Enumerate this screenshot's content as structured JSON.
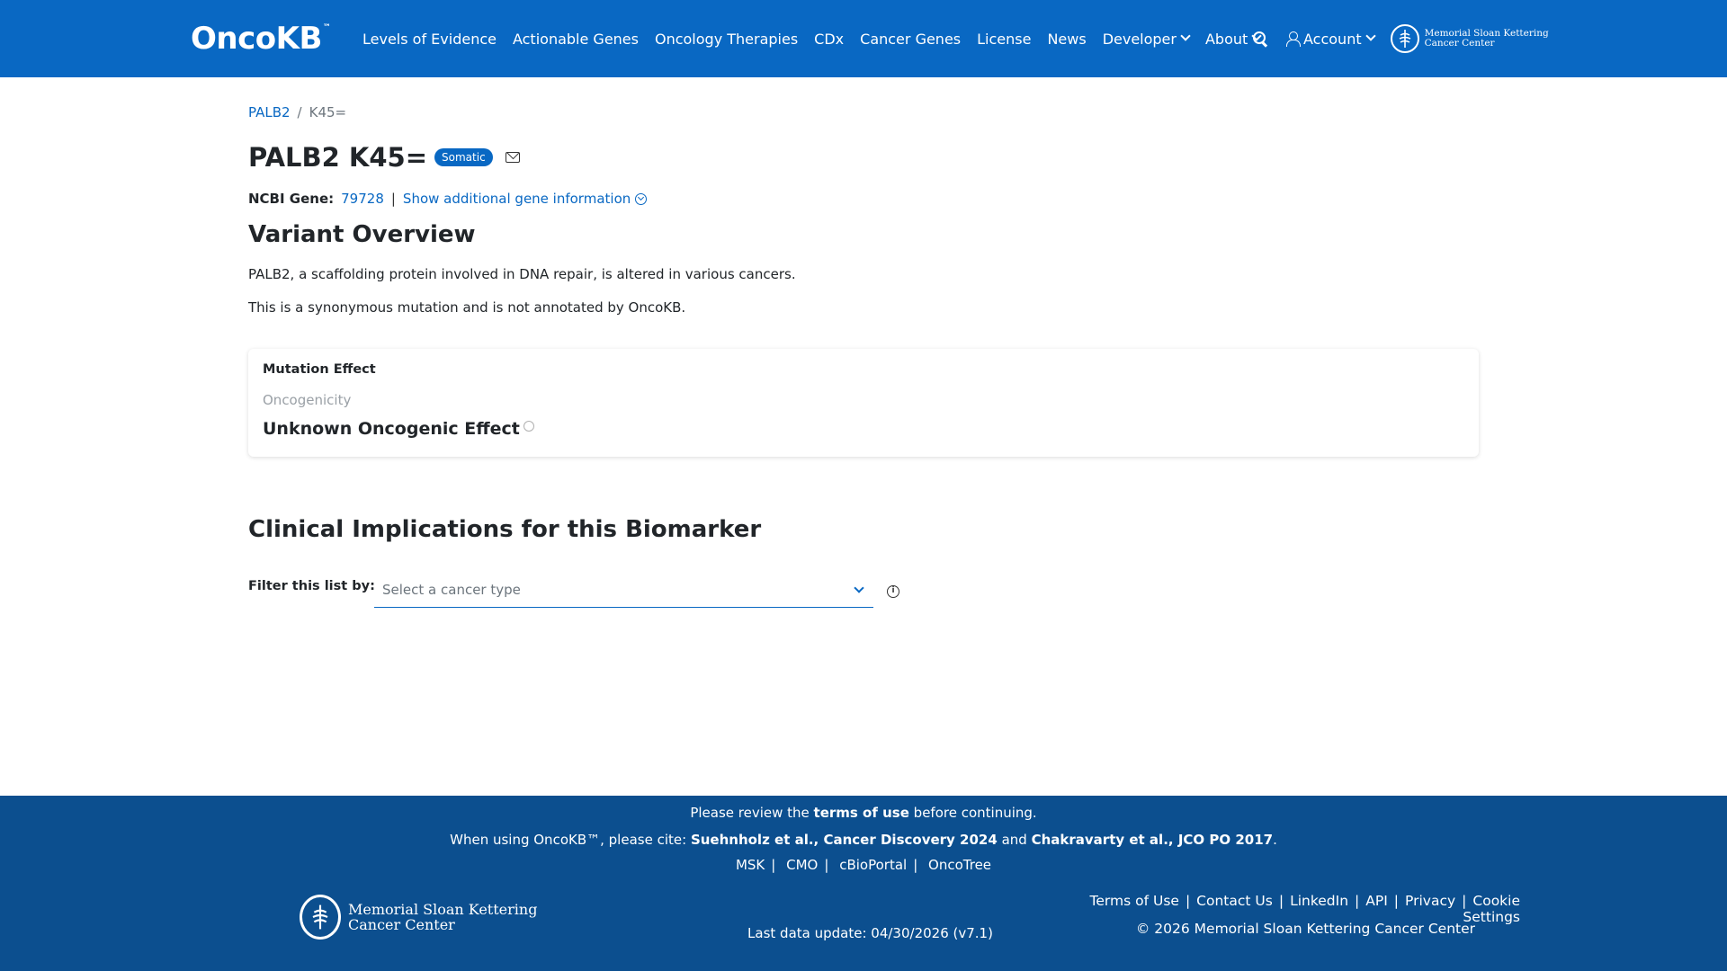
{
  "header": {
    "logo_text": "OncoKB",
    "logo_tm": "™",
    "nav": [
      {
        "label": "Levels of Evidence"
      },
      {
        "label": "Actionable Genes"
      },
      {
        "label": "Oncology Therapies"
      },
      {
        "label": "CDx"
      },
      {
        "label": "Cancer Genes"
      },
      {
        "label": "License"
      },
      {
        "label": "News"
      },
      {
        "label": "Developer"
      },
      {
        "label": "About"
      }
    ],
    "account_label": "Account",
    "msk_line1": "Memorial Sloan Kettering",
    "msk_line2": "Cancer Center",
    "brand_color": "#0968c3"
  },
  "breadcrumb": {
    "gene": "PALB2",
    "separator": "/",
    "variant": "K45="
  },
  "title": {
    "text": "PALB2 K45=",
    "badge": "Somatic"
  },
  "gene_info": {
    "ncbi_label": "NCBI Gene:",
    "ncbi_id": "79728",
    "pipe": "|",
    "show_more": "Show additional gene information"
  },
  "overview": {
    "heading": "Variant Overview",
    "paragraph1": "PALB2, a scaffolding protein involved in DNA repair, is altered in various cancers.",
    "paragraph2": "This is a synonymous mutation and is not annotated by OncoKB."
  },
  "mutation_effect": {
    "title": "Mutation Effect",
    "oncogenicity_label": "Oncogenicity",
    "oncogenicity_value": "Unknown Oncogenic Effect"
  },
  "clinical": {
    "heading": "Clinical Implications for this Biomarker",
    "filter_label": "Filter this list by:",
    "select_placeholder": "Select a cancer type"
  },
  "footer": {
    "review_prefix": "Please review the",
    "review_link": "terms of use",
    "review_suffix": "before continuing.",
    "cite_prefix": "When using OncoKB™, please cite:",
    "cite1": "Suehnholz et al., Cancer Discovery 2024",
    "cite_and": "and",
    "cite2": "Chakravarty et al., JCO PO 2017",
    "cite_end": ".",
    "partner_links": [
      "MSK",
      "CMO",
      "cBioPortal",
      "OncoTree"
    ],
    "msk_line1": "Memorial Sloan Kettering",
    "msk_line2": "Cancer Center",
    "last_update": "Last data update: 04/30/2026 (v7.1)",
    "links": [
      "Terms of Use",
      "Contact Us",
      "LinkedIn",
      "API",
      "Privacy",
      "Cookie Settings"
    ],
    "copyright": "© 2026 Memorial Sloan Kettering Cancer Center",
    "bg_color": "#0c4f8f"
  }
}
